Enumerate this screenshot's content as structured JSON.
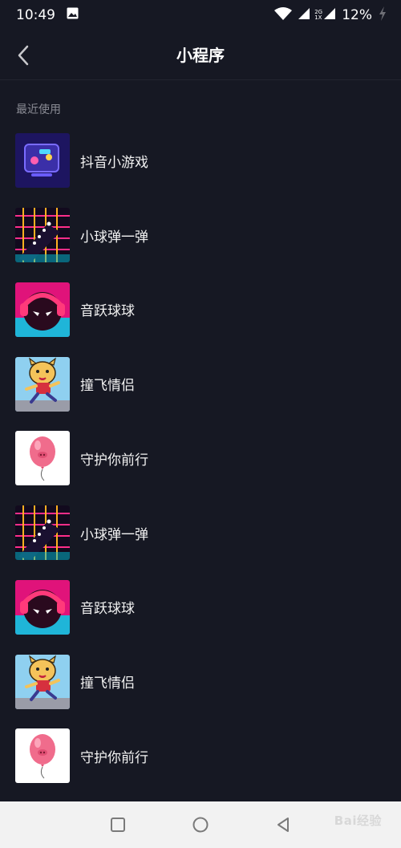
{
  "status_bar": {
    "time": "10:49",
    "battery": "12%",
    "network_label": "2G\n1X",
    "icons": [
      "image-icon",
      "wifi-icon",
      "signal-icon",
      "signal-icon-2",
      "battery-charging-icon"
    ]
  },
  "header": {
    "title": "小程序",
    "back_icon": "chevron-left-icon"
  },
  "section": {
    "label": "最近使用"
  },
  "items": [
    {
      "label": "抖音小游戏",
      "icon": "douyin-minigame"
    },
    {
      "label": "小球弹一弹",
      "icon": "ball-bounce"
    },
    {
      "label": "音跃球球",
      "icon": "music-ball"
    },
    {
      "label": "撞飞情侣",
      "icon": "dog-runner"
    },
    {
      "label": "守护你前行",
      "icon": "pink-balloon"
    },
    {
      "label": "小球弹一弹",
      "icon": "ball-bounce"
    },
    {
      "label": "音跃球球",
      "icon": "music-ball"
    },
    {
      "label": "撞飞情侣",
      "icon": "dog-runner"
    },
    {
      "label": "守护你前行",
      "icon": "pink-balloon"
    }
  ],
  "nav": {
    "buttons": [
      "recent-apps-icon",
      "home-icon",
      "back-icon"
    ]
  },
  "watermark": "Bai经验",
  "colors": {
    "background": "#161823",
    "text": "#ffffff",
    "secondary_text": "#8a8b94",
    "nav_bar": "#f2f2f2"
  }
}
